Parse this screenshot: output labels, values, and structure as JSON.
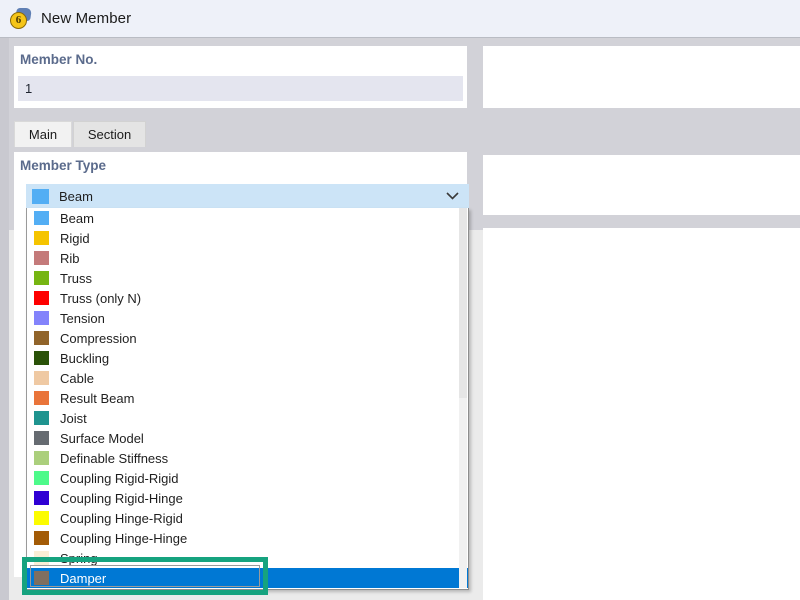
{
  "window": {
    "title": "New Member",
    "icon": "app-badge-icon",
    "icon_glyph": "6"
  },
  "member_no": {
    "label": "Member No.",
    "value": "1",
    "placeholder": ""
  },
  "tabs": [
    {
      "label": "Main",
      "active": true
    },
    {
      "label": "Section",
      "active": false
    }
  ],
  "member_type": {
    "label": "Member Type",
    "selected": {
      "label": "Beam",
      "color": "#53aef4"
    },
    "chevron": "chevron-down-icon"
  },
  "dropdown": {
    "scroll_thumb_percent": 50,
    "options": [
      {
        "label": "Beam",
        "color": "#53aef4"
      },
      {
        "label": "Rigid",
        "color": "#f5c400"
      },
      {
        "label": "Rib",
        "color": "#c47a7a"
      },
      {
        "label": "Truss",
        "color": "#76b512"
      },
      {
        "label": "Truss (only N)",
        "color": "#fe0000"
      },
      {
        "label": "Tension",
        "color": "#8383fb"
      },
      {
        "label": "Compression",
        "color": "#91642a"
      },
      {
        "label": "Buckling",
        "color": "#2a5208"
      },
      {
        "label": "Cable",
        "color": "#efc9a3"
      },
      {
        "label": "Result Beam",
        "color": "#e9743a"
      },
      {
        "label": "Joist",
        "color": "#1f948f"
      },
      {
        "label": "Surface Model",
        "color": "#666b71"
      },
      {
        "label": "Definable Stiffness",
        "color": "#abcf7c"
      },
      {
        "label": "Coupling Rigid-Rigid",
        "color": "#4dfa8a"
      },
      {
        "label": "Coupling Rigid-Hinge",
        "color": "#2f00d4"
      },
      {
        "label": "Coupling Hinge-Rigid",
        "color": "#fcfc00"
      },
      {
        "label": "Coupling Hinge-Hinge",
        "color": "#a35b06"
      },
      {
        "label": "Spring",
        "color": "#faeed6"
      },
      {
        "label": "Damper",
        "color": "#7f6f60"
      }
    ],
    "selected_label": "Damper",
    "highlight_color": "#0078d4"
  },
  "annotation": {
    "target": "Damper",
    "color": "#16a37f"
  }
}
